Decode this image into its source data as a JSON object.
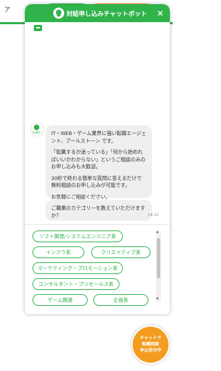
{
  "background": {
    "header_text": "ア"
  },
  "chat": {
    "title": "対話申し込みチャットボット",
    "close_glyph": "×",
    "avatar_text": "ROBO",
    "message1": {
      "p1": "IT・WEB・ゲーム業界に強い転職エージェント、アールストーン です。",
      "p2": "「転職するか迷っている」「何から始めればいいかわからない」というご相談のみのお申し込みも大歓迎。",
      "p3": "30秒で終わる簡単な質問に答えるだけで無料相談のお申し込みが可能です。",
      "p4": "お気軽にご相談ください。"
    },
    "message2": "ご職業のカテゴリーを教えていただけますか？",
    "timestamp": "14:21",
    "options": [
      "ソフト開発/システムエンジニア系",
      "インフラ系",
      "クリエイティブ系",
      "マーケティング・プロモーション系",
      "コンサルタント・プリセールス系",
      "ゲーム関連",
      "企画系"
    ]
  },
  "floating_badge": {
    "line1": "チャットで",
    "line2": "転職相談",
    "line3": "申込受付中"
  },
  "colors": {
    "accent_green": "#2fb34a",
    "accent_orange": "#f39c1f"
  }
}
